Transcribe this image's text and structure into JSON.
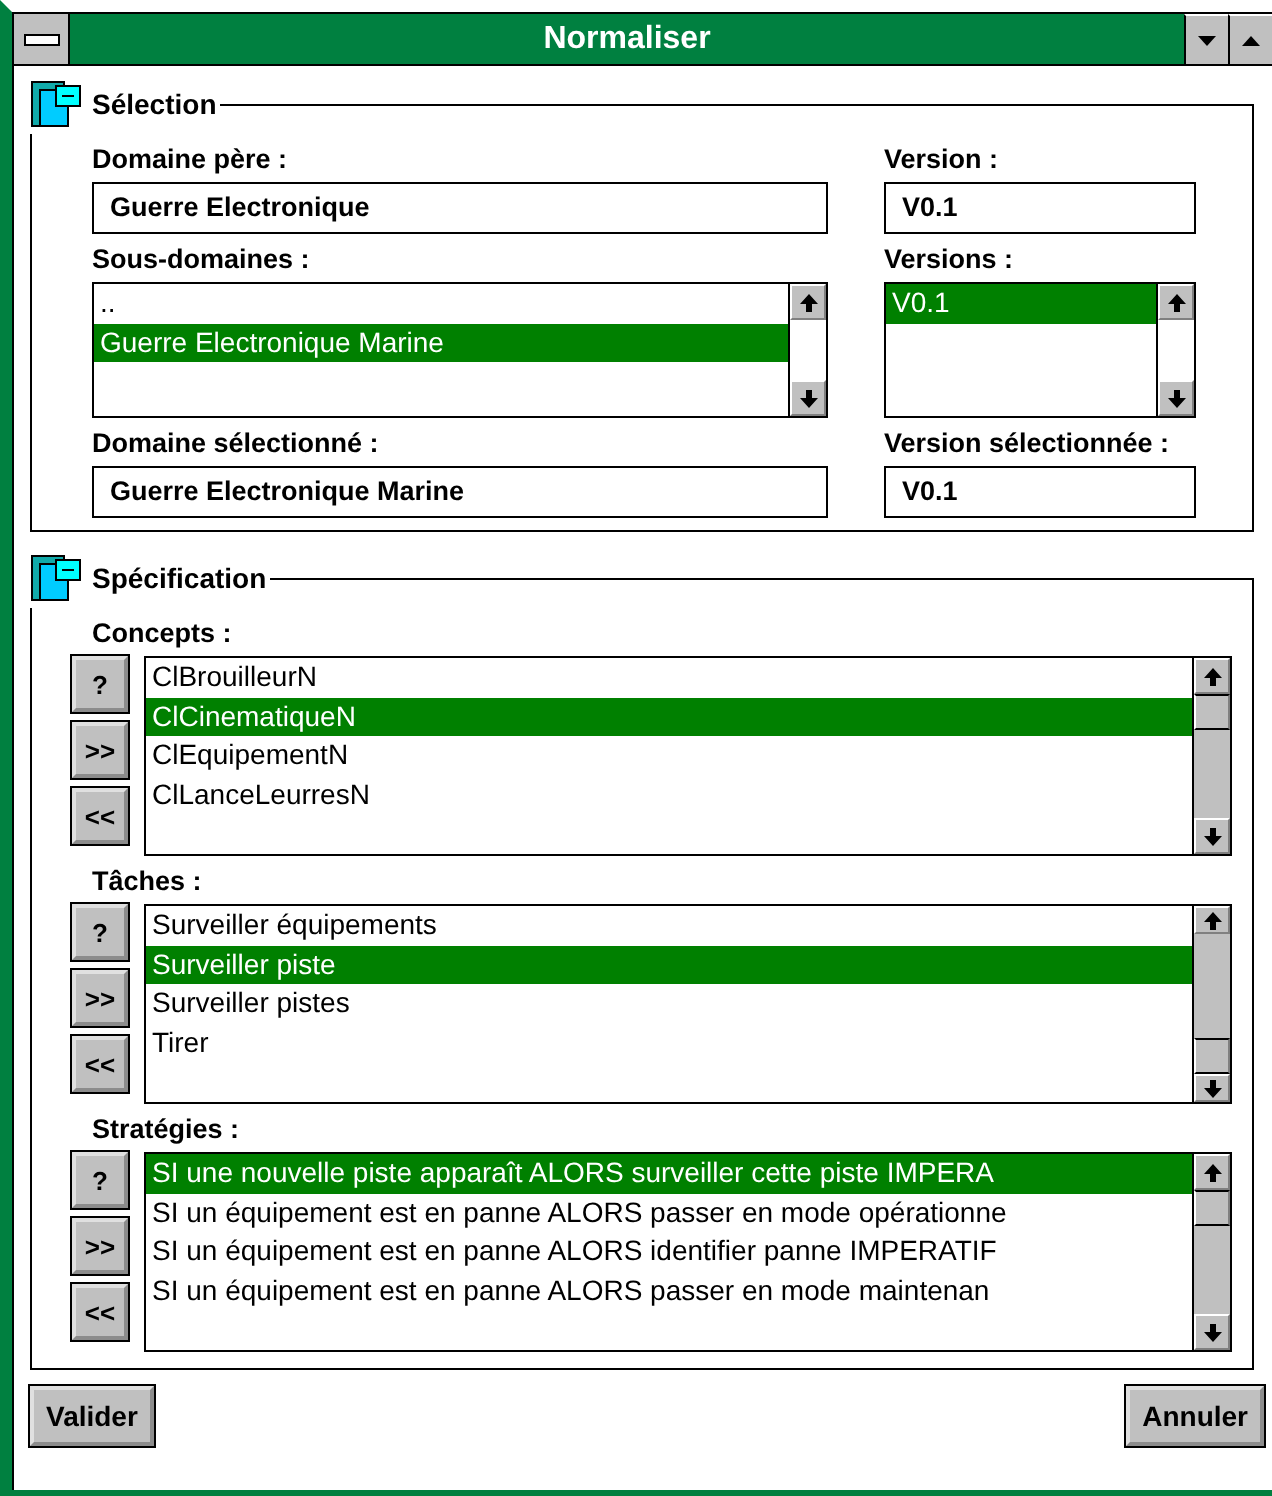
{
  "window": {
    "title": "Normaliser"
  },
  "selection": {
    "title": "Sélection",
    "parent_domain": {
      "label": "Domaine père :",
      "value": "Guerre Electronique"
    },
    "version": {
      "label": "Version :",
      "value": "V0.1"
    },
    "subdomains": {
      "label": "Sous-domaines :",
      "items": [
        {
          "text": "..",
          "selected": false
        },
        {
          "text": "Guerre Electronique Marine",
          "selected": true
        }
      ]
    },
    "versions": {
      "label": "Versions :",
      "items": [
        {
          "text": "V0.1",
          "selected": true
        }
      ]
    },
    "selected_domain": {
      "label": "Domaine sélectionné :",
      "value": "Guerre Electronique Marine"
    },
    "selected_version": {
      "label": "Version sélectionnée :",
      "value": "V0.1"
    }
  },
  "specification": {
    "title": "Spécification",
    "lists": [
      {
        "label": "Concepts :",
        "buttons": [
          "?",
          ">>",
          "<<"
        ],
        "items": [
          {
            "text": "ClBrouilleurN",
            "selected": false
          },
          {
            "text": "ClCinematiqueN",
            "selected": true
          },
          {
            "text": "ClEquipementN",
            "selected": false
          },
          {
            "text": "ClLanceLeurresN",
            "selected": false
          }
        ]
      },
      {
        "label": "Tâches :",
        "buttons": [
          "?",
          ">>",
          "<<"
        ],
        "items": [
          {
            "text": "Surveiller équipements",
            "selected": false
          },
          {
            "text": "Surveiller piste",
            "selected": true
          },
          {
            "text": "Surveiller pistes",
            "selected": false
          },
          {
            "text": "Tirer",
            "selected": false
          }
        ]
      },
      {
        "label": "Stratégies :",
        "buttons": [
          "?",
          ">>",
          "<<"
        ],
        "items": [
          {
            "text": "SI une nouvelle piste apparaît ALORS surveiller cette piste IMPERA",
            "selected": true
          },
          {
            "text": "SI un équipement est en panne ALORS passer en mode opérationne",
            "selected": false
          },
          {
            "text": "SI un équipement est en panne ALORS identifier panne IMPERATIF",
            "selected": false
          },
          {
            "text": "SI un équipement est en panne ALORS passer en mode maintenan",
            "selected": false
          }
        ]
      }
    ]
  },
  "buttons": [
    "Valider",
    "Annuler"
  ]
}
